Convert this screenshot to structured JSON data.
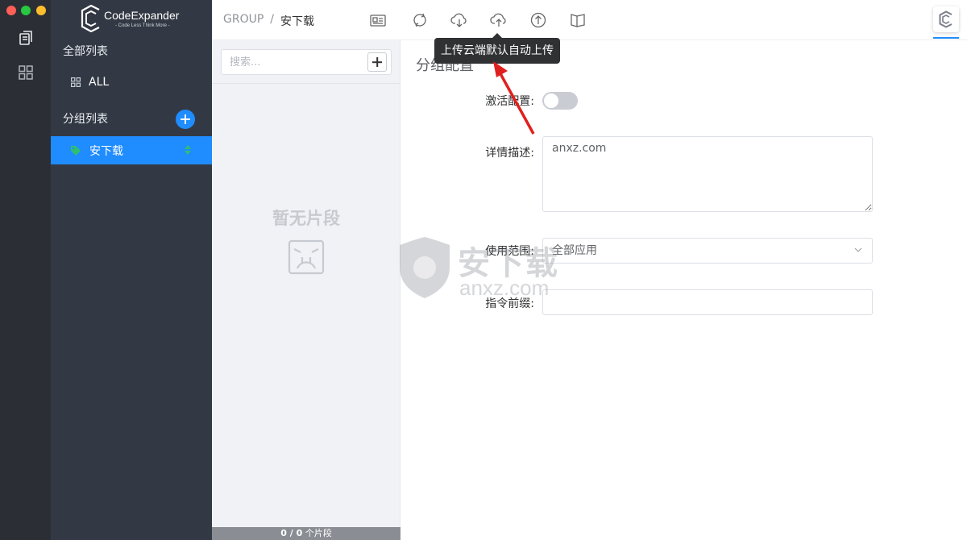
{
  "app": {
    "logo_text": "CodeExpander",
    "logo_tagline": "- Code Less Think More -"
  },
  "sidebar": {
    "all_list_title": "全部列表",
    "all_item_label": "ALL",
    "group_list_title": "分组列表",
    "groups": [
      {
        "label": "安下载",
        "selected": true
      }
    ]
  },
  "header": {
    "breadcrumb_root": "GROUP",
    "breadcrumb_sep": "/",
    "breadcrumb_current": "安下载",
    "tooltip": "上传云端默认自动上传"
  },
  "snippet_list": {
    "search_placeholder": "搜索...",
    "empty_text": "暂无片段",
    "footer_count": "0 / 0",
    "footer_unit": "个片段"
  },
  "form": {
    "title": "分组配置",
    "activate_label": "激活配置:",
    "activate_on": false,
    "description_label": "详情描述:",
    "description_value": "anxz.com",
    "scope_label": "使用范围:",
    "scope_value": "全部应用",
    "command_prefix_label": "指令前缀:",
    "command_prefix_value": ""
  },
  "watermark": {
    "text": "安下载",
    "sub": "anxz.com"
  },
  "colors": {
    "accent": "#1f8cff",
    "sidebar_bg": "#333944",
    "rail_bg": "#2b2f35",
    "arrow": "#e0201e"
  }
}
